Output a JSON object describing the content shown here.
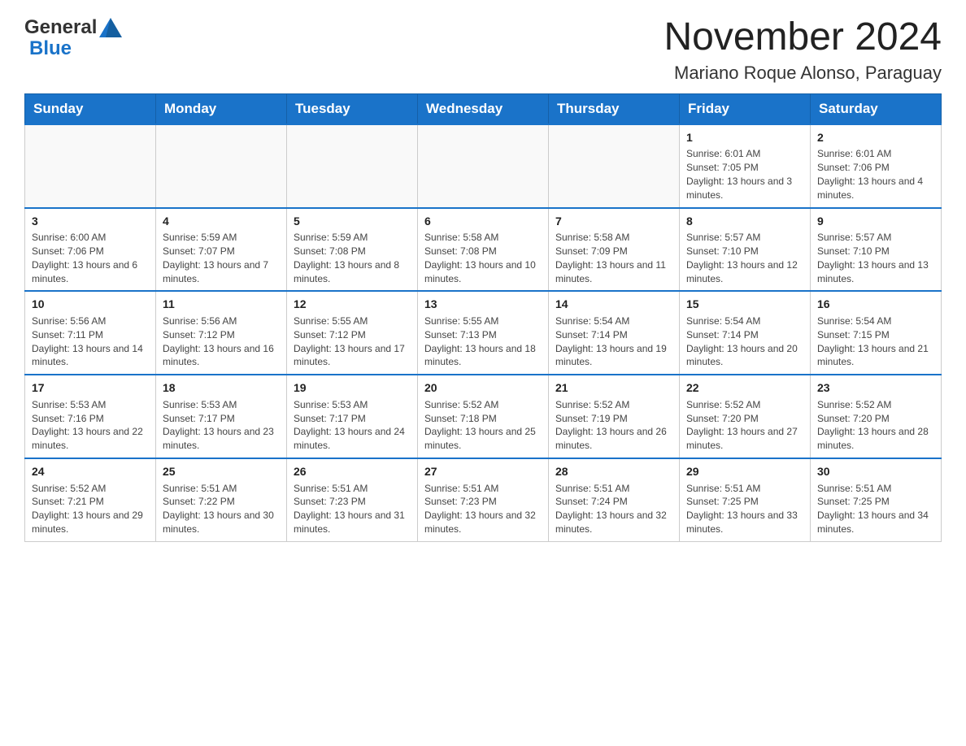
{
  "header": {
    "month_title": "November 2024",
    "location": "Mariano Roque Alonso, Paraguay"
  },
  "logo": {
    "general": "General",
    "blue": "Blue"
  },
  "days_of_week": [
    "Sunday",
    "Monday",
    "Tuesday",
    "Wednesday",
    "Thursday",
    "Friday",
    "Saturday"
  ],
  "weeks": [
    [
      {
        "day": "",
        "sunrise": "",
        "sunset": "",
        "daylight": ""
      },
      {
        "day": "",
        "sunrise": "",
        "sunset": "",
        "daylight": ""
      },
      {
        "day": "",
        "sunrise": "",
        "sunset": "",
        "daylight": ""
      },
      {
        "day": "",
        "sunrise": "",
        "sunset": "",
        "daylight": ""
      },
      {
        "day": "",
        "sunrise": "",
        "sunset": "",
        "daylight": ""
      },
      {
        "day": "1",
        "sunrise": "Sunrise: 6:01 AM",
        "sunset": "Sunset: 7:05 PM",
        "daylight": "Daylight: 13 hours and 3 minutes."
      },
      {
        "day": "2",
        "sunrise": "Sunrise: 6:01 AM",
        "sunset": "Sunset: 7:06 PM",
        "daylight": "Daylight: 13 hours and 4 minutes."
      }
    ],
    [
      {
        "day": "3",
        "sunrise": "Sunrise: 6:00 AM",
        "sunset": "Sunset: 7:06 PM",
        "daylight": "Daylight: 13 hours and 6 minutes."
      },
      {
        "day": "4",
        "sunrise": "Sunrise: 5:59 AM",
        "sunset": "Sunset: 7:07 PM",
        "daylight": "Daylight: 13 hours and 7 minutes."
      },
      {
        "day": "5",
        "sunrise": "Sunrise: 5:59 AM",
        "sunset": "Sunset: 7:08 PM",
        "daylight": "Daylight: 13 hours and 8 minutes."
      },
      {
        "day": "6",
        "sunrise": "Sunrise: 5:58 AM",
        "sunset": "Sunset: 7:08 PM",
        "daylight": "Daylight: 13 hours and 10 minutes."
      },
      {
        "day": "7",
        "sunrise": "Sunrise: 5:58 AM",
        "sunset": "Sunset: 7:09 PM",
        "daylight": "Daylight: 13 hours and 11 minutes."
      },
      {
        "day": "8",
        "sunrise": "Sunrise: 5:57 AM",
        "sunset": "Sunset: 7:10 PM",
        "daylight": "Daylight: 13 hours and 12 minutes."
      },
      {
        "day": "9",
        "sunrise": "Sunrise: 5:57 AM",
        "sunset": "Sunset: 7:10 PM",
        "daylight": "Daylight: 13 hours and 13 minutes."
      }
    ],
    [
      {
        "day": "10",
        "sunrise": "Sunrise: 5:56 AM",
        "sunset": "Sunset: 7:11 PM",
        "daylight": "Daylight: 13 hours and 14 minutes."
      },
      {
        "day": "11",
        "sunrise": "Sunrise: 5:56 AM",
        "sunset": "Sunset: 7:12 PM",
        "daylight": "Daylight: 13 hours and 16 minutes."
      },
      {
        "day": "12",
        "sunrise": "Sunrise: 5:55 AM",
        "sunset": "Sunset: 7:12 PM",
        "daylight": "Daylight: 13 hours and 17 minutes."
      },
      {
        "day": "13",
        "sunrise": "Sunrise: 5:55 AM",
        "sunset": "Sunset: 7:13 PM",
        "daylight": "Daylight: 13 hours and 18 minutes."
      },
      {
        "day": "14",
        "sunrise": "Sunrise: 5:54 AM",
        "sunset": "Sunset: 7:14 PM",
        "daylight": "Daylight: 13 hours and 19 minutes."
      },
      {
        "day": "15",
        "sunrise": "Sunrise: 5:54 AM",
        "sunset": "Sunset: 7:14 PM",
        "daylight": "Daylight: 13 hours and 20 minutes."
      },
      {
        "day": "16",
        "sunrise": "Sunrise: 5:54 AM",
        "sunset": "Sunset: 7:15 PM",
        "daylight": "Daylight: 13 hours and 21 minutes."
      }
    ],
    [
      {
        "day": "17",
        "sunrise": "Sunrise: 5:53 AM",
        "sunset": "Sunset: 7:16 PM",
        "daylight": "Daylight: 13 hours and 22 minutes."
      },
      {
        "day": "18",
        "sunrise": "Sunrise: 5:53 AM",
        "sunset": "Sunset: 7:17 PM",
        "daylight": "Daylight: 13 hours and 23 minutes."
      },
      {
        "day": "19",
        "sunrise": "Sunrise: 5:53 AM",
        "sunset": "Sunset: 7:17 PM",
        "daylight": "Daylight: 13 hours and 24 minutes."
      },
      {
        "day": "20",
        "sunrise": "Sunrise: 5:52 AM",
        "sunset": "Sunset: 7:18 PM",
        "daylight": "Daylight: 13 hours and 25 minutes."
      },
      {
        "day": "21",
        "sunrise": "Sunrise: 5:52 AM",
        "sunset": "Sunset: 7:19 PM",
        "daylight": "Daylight: 13 hours and 26 minutes."
      },
      {
        "day": "22",
        "sunrise": "Sunrise: 5:52 AM",
        "sunset": "Sunset: 7:20 PM",
        "daylight": "Daylight: 13 hours and 27 minutes."
      },
      {
        "day": "23",
        "sunrise": "Sunrise: 5:52 AM",
        "sunset": "Sunset: 7:20 PM",
        "daylight": "Daylight: 13 hours and 28 minutes."
      }
    ],
    [
      {
        "day": "24",
        "sunrise": "Sunrise: 5:52 AM",
        "sunset": "Sunset: 7:21 PM",
        "daylight": "Daylight: 13 hours and 29 minutes."
      },
      {
        "day": "25",
        "sunrise": "Sunrise: 5:51 AM",
        "sunset": "Sunset: 7:22 PM",
        "daylight": "Daylight: 13 hours and 30 minutes."
      },
      {
        "day": "26",
        "sunrise": "Sunrise: 5:51 AM",
        "sunset": "Sunset: 7:23 PM",
        "daylight": "Daylight: 13 hours and 31 minutes."
      },
      {
        "day": "27",
        "sunrise": "Sunrise: 5:51 AM",
        "sunset": "Sunset: 7:23 PM",
        "daylight": "Daylight: 13 hours and 32 minutes."
      },
      {
        "day": "28",
        "sunrise": "Sunrise: 5:51 AM",
        "sunset": "Sunset: 7:24 PM",
        "daylight": "Daylight: 13 hours and 32 minutes."
      },
      {
        "day": "29",
        "sunrise": "Sunrise: 5:51 AM",
        "sunset": "Sunset: 7:25 PM",
        "daylight": "Daylight: 13 hours and 33 minutes."
      },
      {
        "day": "30",
        "sunrise": "Sunrise: 5:51 AM",
        "sunset": "Sunset: 7:25 PM",
        "daylight": "Daylight: 13 hours and 34 minutes."
      }
    ]
  ]
}
